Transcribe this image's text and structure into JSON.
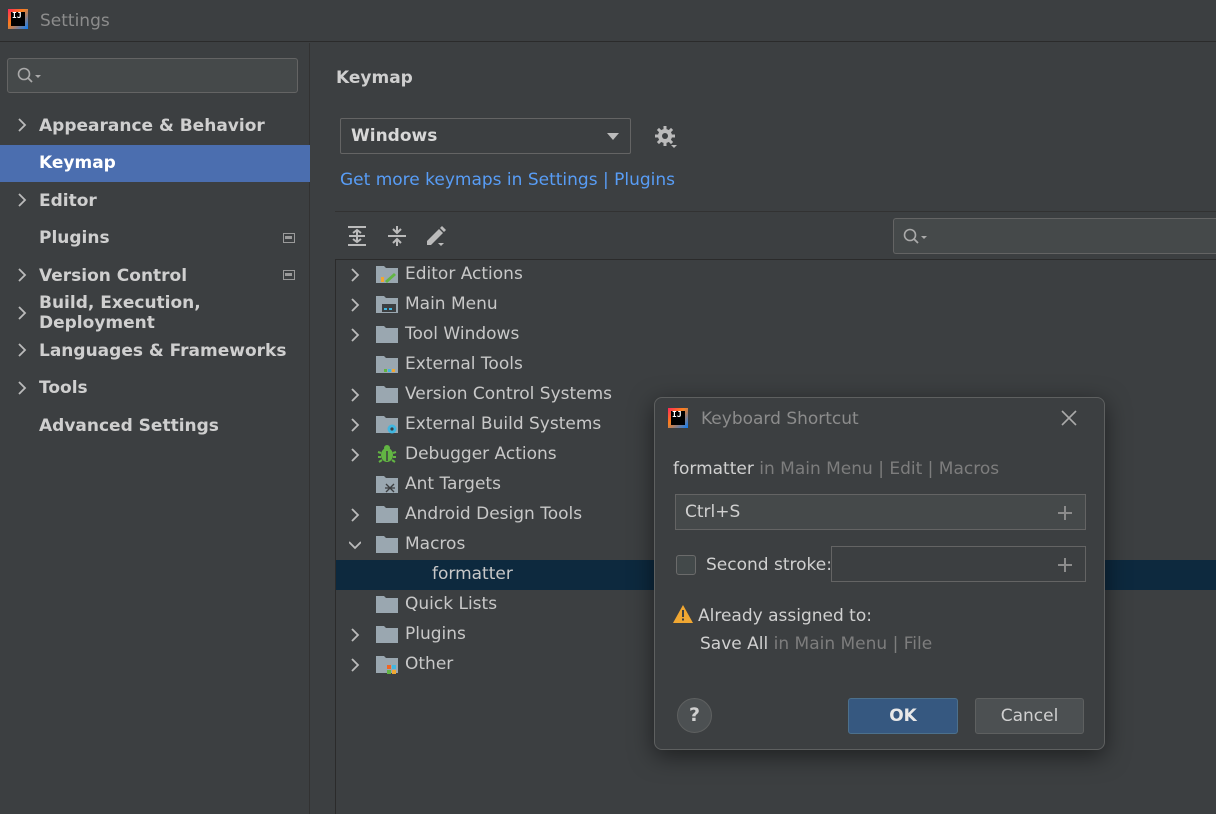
{
  "window": {
    "title": "Settings",
    "app_icon_text": "IJ"
  },
  "sidebar": {
    "search_placeholder": "",
    "items": [
      {
        "label": "Appearance & Behavior",
        "expandable": true
      },
      {
        "label": "Keymap",
        "expandable": false,
        "selected": true
      },
      {
        "label": "Editor",
        "expandable": true
      },
      {
        "label": "Plugins",
        "expandable": false,
        "project_icon": true
      },
      {
        "label": "Version Control",
        "expandable": true,
        "project_icon": true
      },
      {
        "label": "Build, Execution, Deployment",
        "expandable": true
      },
      {
        "label": "Languages & Frameworks",
        "expandable": true
      },
      {
        "label": "Tools",
        "expandable": true
      },
      {
        "label": "Advanced Settings",
        "expandable": false
      }
    ]
  },
  "main": {
    "title": "Keymap",
    "keymap_value": "Windows",
    "get_more_link": "Get more keymaps in Settings | Plugins",
    "tree": [
      {
        "label": "Editor Actions",
        "expandable": true,
        "icon": "editor-actions-folder-icon"
      },
      {
        "label": "Main Menu",
        "expandable": true,
        "icon": "main-menu-folder-icon"
      },
      {
        "label": "Tool Windows",
        "expandable": true,
        "icon": "folder-icon"
      },
      {
        "label": "External Tools",
        "expandable": false,
        "icon": "external-tools-folder-icon"
      },
      {
        "label": "Version Control Systems",
        "expandable": true,
        "icon": "folder-icon"
      },
      {
        "label": "External Build Systems",
        "expandable": true,
        "icon": "build-systems-folder-icon"
      },
      {
        "label": "Debugger Actions",
        "expandable": true,
        "icon": "bug-icon"
      },
      {
        "label": "Ant Targets",
        "expandable": false,
        "icon": "ant-folder-icon"
      },
      {
        "label": "Android Design Tools",
        "expandable": true,
        "icon": "folder-icon"
      },
      {
        "label": "Macros",
        "expandable": true,
        "expanded": true,
        "icon": "folder-icon"
      },
      {
        "label": "formatter",
        "child": true,
        "selected": true
      },
      {
        "label": "Quick Lists",
        "expandable": false,
        "icon": "folder-icon"
      },
      {
        "label": "Plugins",
        "expandable": true,
        "icon": "folder-icon"
      },
      {
        "label": "Other",
        "expandable": true,
        "icon": "other-folder-icon"
      }
    ]
  },
  "dialog": {
    "title": "Keyboard Shortcut",
    "action_name": "formatter",
    "action_path": " in Main Menu | Edit | Macros",
    "first_stroke": "Ctrl+S",
    "second_stroke_label": "Second stroke:",
    "second_stroke_value": "",
    "already_assigned": "Already assigned to:",
    "conflict_action": "Save All",
    "conflict_path": " in Main Menu | File",
    "help": "?",
    "ok": "OK",
    "cancel": "Cancel"
  },
  "colors": {
    "background": "#3c3f41",
    "selection_sidebar": "#4b6eaf",
    "selection_tree": "#0d293e",
    "link": "#589df6",
    "ok_button": "#365880",
    "warning": "#f0a732"
  }
}
